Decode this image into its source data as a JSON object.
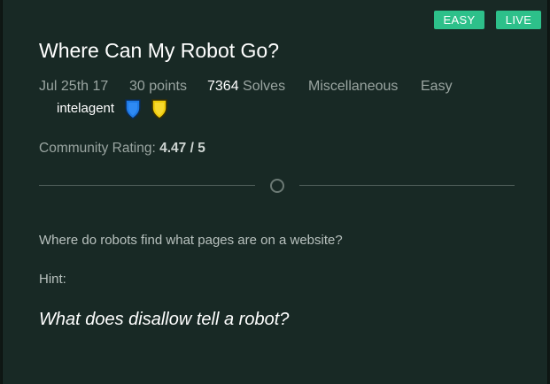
{
  "badges": {
    "difficulty": "EASY",
    "status": "LIVE",
    "color": "#2dc08a"
  },
  "challenge": {
    "title": "Where Can My Robot Go?",
    "date": "Jul 25th 17",
    "points": "30 points",
    "solves_count": "7364",
    "solves_label": "Solves",
    "category": "Miscellaneous",
    "difficulty": "Easy"
  },
  "author": {
    "name": "intelagent",
    "badges": [
      {
        "icon": "blue-shield-icon",
        "color": "#1e7ae6"
      },
      {
        "icon": "gold-shield-icon",
        "color": "#f0cc0c"
      }
    ]
  },
  "rating": {
    "label": "Community Rating:",
    "value": "4.47 / 5"
  },
  "content": {
    "description": "Where do robots find what pages are on a website?",
    "hint_label": "Hint:",
    "hint": "What does disallow tell a robot?"
  },
  "colors": {
    "background": "#182925",
    "accent": "#2dc08a"
  }
}
